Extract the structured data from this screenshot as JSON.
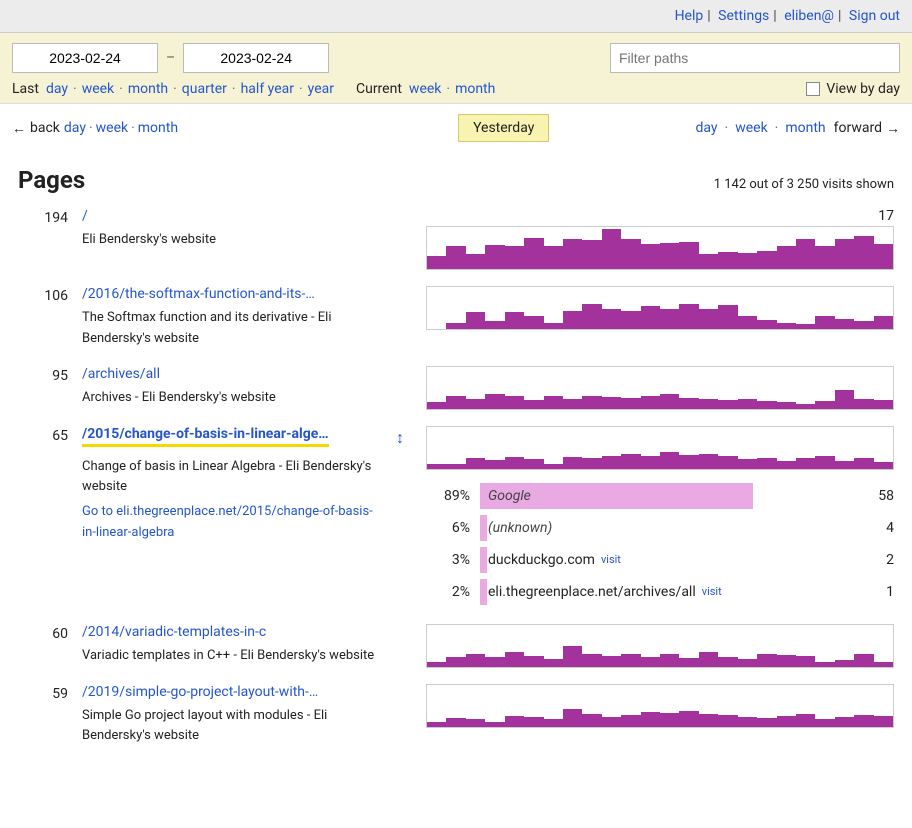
{
  "topbar": {
    "help": "Help",
    "settings": "Settings",
    "user": "eliben@",
    "signout": "Sign out"
  },
  "filter": {
    "date_from": "2023-02-24",
    "date_to": "2023-02-24",
    "dash": "–",
    "filter_placeholder": "Filter paths",
    "last_label": "Last",
    "last_day": "day",
    "last_week": "week",
    "last_month": "month",
    "last_quarter": "quarter",
    "last_halfyear": "half year",
    "last_year": "year",
    "current_label": "Current",
    "current_week": "week",
    "current_month": "month",
    "viewbyday": "View by day"
  },
  "nav": {
    "back_arrow": "←",
    "back_label": "back",
    "back_day": "day",
    "back_week": "week",
    "back_month": "month",
    "yesterday": "Yesterday",
    "fwd_day": "day",
    "fwd_week": "week",
    "fwd_month": "month",
    "fwd_label": "forward",
    "fwd_arrow": "→"
  },
  "section": {
    "title": "Pages",
    "count": "1 142 out of 3 250 visits shown"
  },
  "rows": [
    {
      "n": "194",
      "path": "/",
      "title": "Eli Bendersky's website",
      "topnum": "17",
      "spark": [
        30,
        55,
        35,
        58,
        55,
        75,
        55,
        72,
        68,
        95,
        72,
        60,
        62,
        65,
        35,
        40,
        38,
        42,
        55,
        72,
        55,
        72,
        78,
        60
      ]
    },
    {
      "n": "106",
      "path": "/2016/the-softmax-function-and-its-…",
      "title": "The Softmax function and its derivative - Eli Bendersky's website",
      "spark": [
        0,
        15,
        40,
        18,
        40,
        30,
        15,
        42,
        60,
        48,
        42,
        55,
        48,
        60,
        48,
        58,
        30,
        22,
        15,
        12,
        30,
        25,
        18,
        30
      ]
    },
    {
      "n": "95",
      "path": "/archives/all",
      "title": "Archives - Eli Bendersky's website",
      "spark": [
        15,
        30,
        22,
        35,
        30,
        20,
        30,
        22,
        30,
        28,
        25,
        30,
        35,
        25,
        22,
        20,
        22,
        18,
        15,
        12,
        18,
        45,
        22,
        20
      ]
    },
    {
      "n": "65",
      "path": "/2015/change-of-basis-in-linear-alge…",
      "title": "Change of basis in Linear Algebra - Eli Bendersky's website",
      "goto": "Go to eli.thegreenplace.net/2015/change-of-basis-in-linear-algebra",
      "selected": true,
      "spark": [
        12,
        10,
        25,
        20,
        28,
        22,
        12,
        28,
        25,
        30,
        35,
        30,
        40,
        32,
        35,
        30,
        22,
        25,
        18,
        25,
        30,
        18,
        25,
        15
      ],
      "refs": [
        {
          "pct": "89%",
          "label": "Google",
          "cnt": "58",
          "w": 73,
          "italic": true
        },
        {
          "pct": "6%",
          "label": "(unknown)",
          "cnt": "4",
          "w": 2,
          "italic": true
        },
        {
          "pct": "3%",
          "label": "duckduckgo.com",
          "cnt": "2",
          "w": 2,
          "visit": "visit"
        },
        {
          "pct": "2%",
          "label": "eli.thegreenplace.net/archives/all",
          "cnt": "1",
          "w": 2,
          "visit": "visit"
        }
      ]
    },
    {
      "n": "60",
      "path": "/2014/variadic-templates-in-c",
      "title": "Variadic templates in C++ - Eli Bendersky's website",
      "spark": [
        10,
        22,
        30,
        22,
        35,
        25,
        18,
        50,
        30,
        25,
        30,
        22,
        30,
        20,
        35,
        22,
        18,
        30,
        28,
        25,
        12,
        15,
        30,
        12
      ]
    },
    {
      "n": "59",
      "path": "/2019/simple-go-project-layout-with-…",
      "title": "Simple Go project layout with modules - Eli Bendersky's website",
      "spark": [
        12,
        20,
        18,
        12,
        25,
        22,
        18,
        42,
        30,
        22,
        28,
        35,
        32,
        38,
        30,
        28,
        22,
        20,
        25,
        30,
        18,
        22,
        28,
        25
      ]
    }
  ]
}
